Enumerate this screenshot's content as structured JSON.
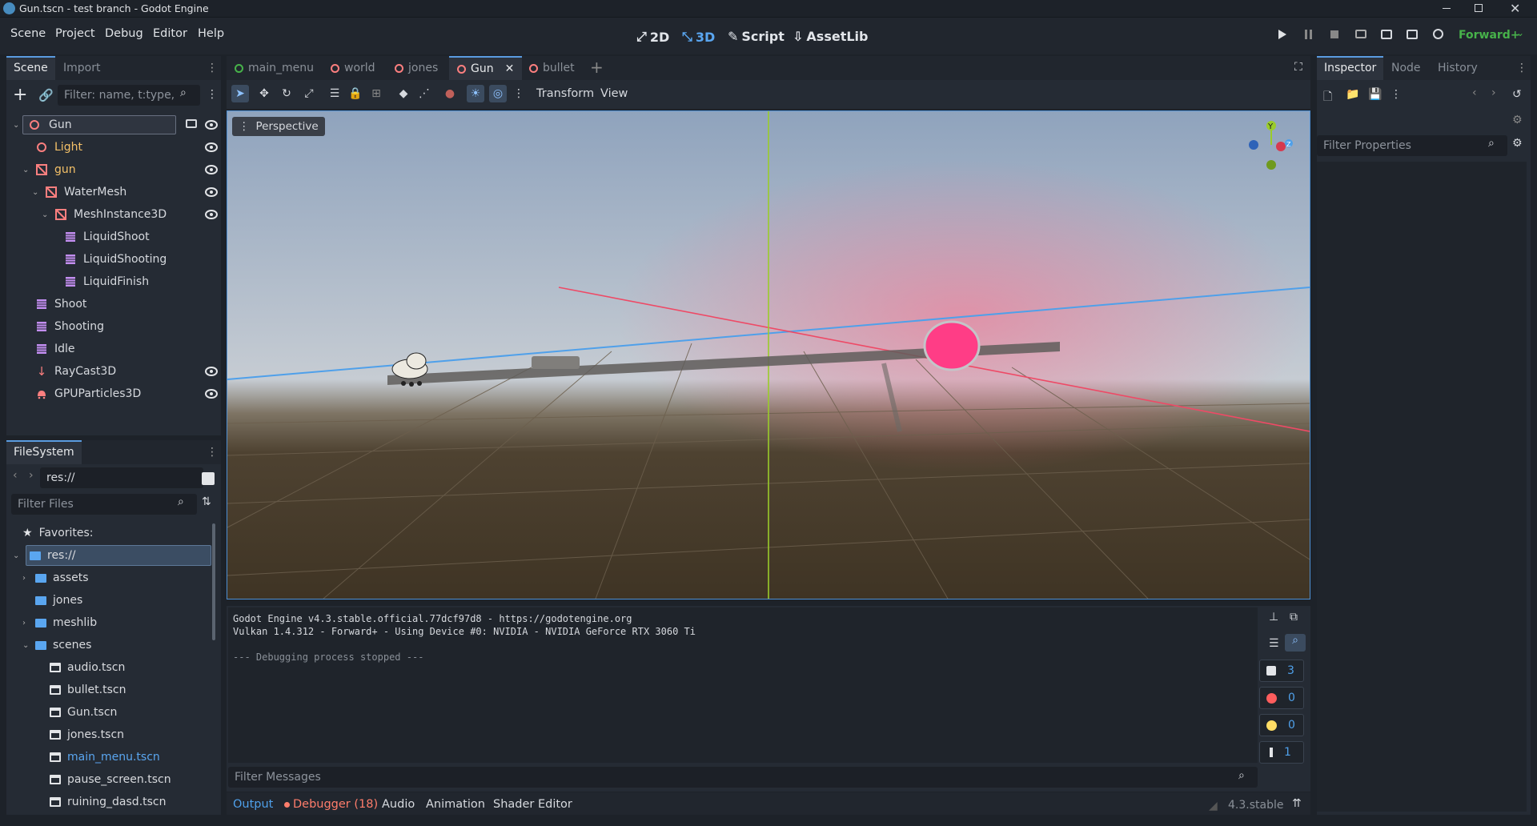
{
  "window": {
    "title": "Gun.tscn - test branch - Godot Engine"
  },
  "menu": {
    "items": [
      "Scene",
      "Project",
      "Debug",
      "Editor",
      "Help"
    ]
  },
  "main_screens": {
    "d2": "2D",
    "d3": "3D",
    "script": "Script",
    "assetlib": "AssetLib"
  },
  "renderer": {
    "label": "Forward+"
  },
  "scene_dock": {
    "tabs": [
      "Scene",
      "Import"
    ],
    "filter_placeholder": "Filter: name, t:type,",
    "nodes": [
      {
        "name": "Gun",
        "type": "node3d"
      },
      {
        "name": "Light",
        "type": "node3d"
      },
      {
        "name": "gun",
        "type": "mesh"
      },
      {
        "name": "WaterMesh",
        "type": "mesh"
      },
      {
        "name": "MeshInstance3D",
        "type": "mesh"
      },
      {
        "name": "LiquidShoot",
        "type": "anim"
      },
      {
        "name": "LiquidShooting",
        "type": "anim"
      },
      {
        "name": "LiquidFinish",
        "type": "anim"
      },
      {
        "name": "Shoot",
        "type": "anim"
      },
      {
        "name": "Shooting",
        "type": "anim"
      },
      {
        "name": "Idle",
        "type": "anim"
      },
      {
        "name": "RayCast3D",
        "type": "raycast"
      },
      {
        "name": "GPUParticles3D",
        "type": "particles"
      }
    ]
  },
  "filesystem": {
    "tab": "FileSystem",
    "path": "res://",
    "filter_placeholder": "Filter Files",
    "favorites": "Favorites:",
    "items": [
      {
        "name": "res://",
        "kind": "folder"
      },
      {
        "name": "assets",
        "kind": "folder"
      },
      {
        "name": "jones",
        "kind": "folder"
      },
      {
        "name": "meshlib",
        "kind": "folder"
      },
      {
        "name": "scenes",
        "kind": "folder"
      },
      {
        "name": "audio.tscn",
        "kind": "scene"
      },
      {
        "name": "bullet.tscn",
        "kind": "scene"
      },
      {
        "name": "Gun.tscn",
        "kind": "scene"
      },
      {
        "name": "jones.tscn",
        "kind": "scene"
      },
      {
        "name": "main_menu.tscn",
        "kind": "scene"
      },
      {
        "name": "pause_screen.tscn",
        "kind": "scene"
      },
      {
        "name": "ruining_dasd.tscn",
        "kind": "scene"
      }
    ]
  },
  "scene_tabs": [
    "main_menu",
    "world",
    "jones",
    "Gun",
    "bullet"
  ],
  "toolbar": {
    "transform": "Transform",
    "view": "View"
  },
  "viewport": {
    "mode": "Perspective",
    "gizmo_y": "Y",
    "gizmo_z": "Z"
  },
  "output": {
    "lines": [
      "Godot Engine v4.3.stable.official.77dcf97d8 - https://godotengine.org",
      "Vulkan 1.4.312 - Forward+ - Using Device #0: NVIDIA - NVIDIA GeForce RTX 3060 Ti",
      "",
      "--- Debugging process stopped ---"
    ],
    "filter_placeholder": "Filter Messages",
    "counts": {
      "messages": "3",
      "errors": "0",
      "warnings": "0",
      "info": "1"
    }
  },
  "bottom_tabs": {
    "output": "Output",
    "debugger": "Debugger (18)",
    "audio": "Audio",
    "animation": "Animation",
    "shader": "Shader Editor"
  },
  "version": "4.3.stable",
  "inspector": {
    "tabs": [
      "Inspector",
      "Node",
      "History"
    ],
    "filter_placeholder": "Filter Properties"
  },
  "colors": {
    "accent": "#4fa0ea",
    "scene_link": "#5aa6f0",
    "debugger": "#ff7d6b",
    "renderer": "#47b24a"
  }
}
